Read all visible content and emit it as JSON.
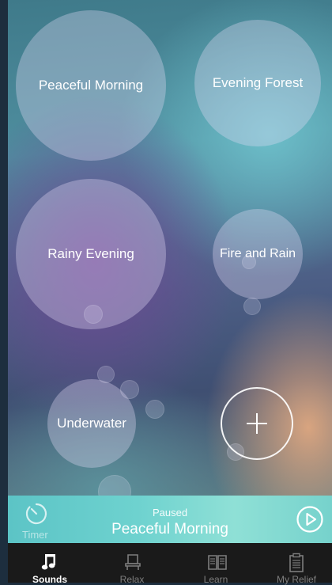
{
  "sounds": [
    {
      "id": "peaceful-morning",
      "label": "Peaceful Morning"
    },
    {
      "id": "evening-forest",
      "label": "Evening Forest"
    },
    {
      "id": "rainy-evening",
      "label": "Rainy Evening"
    },
    {
      "id": "fire-and-rain",
      "label": "Fire and Rain"
    },
    {
      "id": "underwater",
      "label": "Underwater"
    }
  ],
  "add_button": {
    "icon": "plus-icon"
  },
  "player": {
    "timer_label": "Timer",
    "status": "Paused",
    "track": "Peaceful Morning",
    "timer_icon": "timer-icon",
    "play_icon": "play-icon"
  },
  "tabs": [
    {
      "label": "Sounds",
      "icon": "music-note-icon",
      "active": true
    },
    {
      "label": "Relax",
      "icon": "lounge-chair-icon",
      "active": false
    },
    {
      "label": "Learn",
      "icon": "book-icon",
      "active": false
    },
    {
      "label": "My Relief",
      "icon": "clipboard-icon",
      "active": false
    }
  ],
  "colors": {
    "player_bar": "#6ed2cf",
    "tab_bar": "#1a1a1a",
    "tab_active": "#ffffff",
    "tab_inactive": "#7d7d7d"
  }
}
